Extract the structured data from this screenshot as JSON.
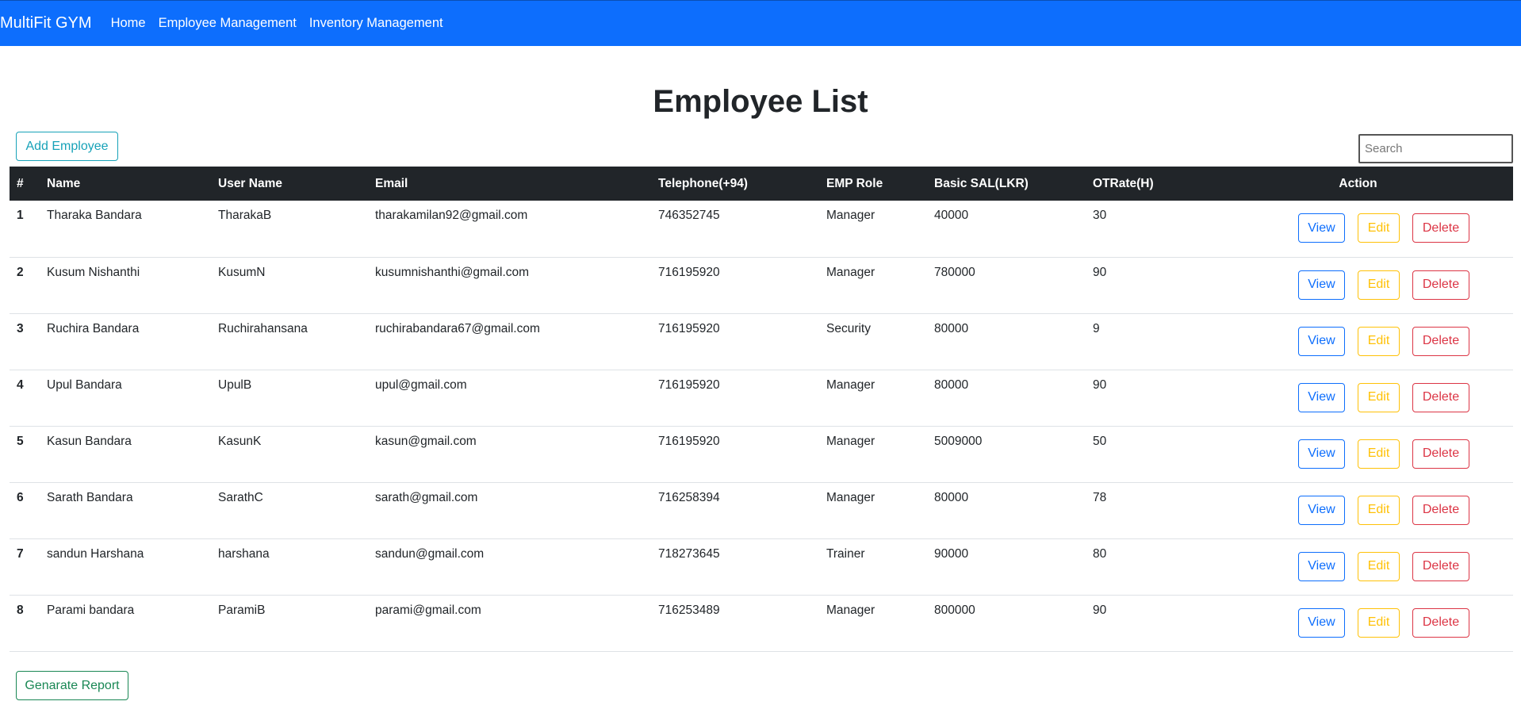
{
  "navbar": {
    "brand": "MultiFit GYM",
    "links": [
      "Home",
      "Employee Management",
      "Inventory Management"
    ]
  },
  "page": {
    "title": "Employee List"
  },
  "toolbar": {
    "add_label": "Add Employee",
    "search_placeholder": "Search"
  },
  "table": {
    "headers": [
      "#",
      "Name",
      "User Name",
      "Email",
      "Telephone(+94)",
      "EMP Role",
      "Basic SAL(LKR)",
      "OTRate(H)",
      "Action"
    ],
    "rows": [
      {
        "num": "1",
        "name": "Tharaka Bandara",
        "username": "TharakaB",
        "email": "tharakamilan92@gmail.com",
        "telephone": "746352745",
        "role": "Manager",
        "salary": "40000",
        "otrate": "30"
      },
      {
        "num": "2",
        "name": "Kusum Nishanthi",
        "username": "KusumN",
        "email": "kusumnishanthi@gmail.com",
        "telephone": "716195920",
        "role": "Manager",
        "salary": "780000",
        "otrate": "90"
      },
      {
        "num": "3",
        "name": "Ruchira Bandara",
        "username": "Ruchirahansana",
        "email": "ruchirabandara67@gmail.com",
        "telephone": "716195920",
        "role": "Security",
        "salary": "80000",
        "otrate": "9"
      },
      {
        "num": "4",
        "name": "Upul Bandara",
        "username": "UpulB",
        "email": "upul@gmail.com",
        "telephone": "716195920",
        "role": "Manager",
        "salary": "80000",
        "otrate": "90"
      },
      {
        "num": "5",
        "name": "Kasun Bandara",
        "username": "KasunK",
        "email": "kasun@gmail.com",
        "telephone": "716195920",
        "role": "Manager",
        "salary": "5009000",
        "otrate": "50"
      },
      {
        "num": "6",
        "name": "Sarath Bandara",
        "username": "SarathC",
        "email": "sarath@gmail.com",
        "telephone": "716258394",
        "role": "Manager",
        "salary": "80000",
        "otrate": "78"
      },
      {
        "num": "7",
        "name": "sandun Harshana",
        "username": "harshana",
        "email": "sandun@gmail.com",
        "telephone": "718273645",
        "role": "Trainer",
        "salary": "90000",
        "otrate": "80"
      },
      {
        "num": "8",
        "name": "Parami bandara",
        "username": "ParamiB",
        "email": "parami@gmail.com",
        "telephone": "716253489",
        "role": "Manager",
        "salary": "800000",
        "otrate": "90"
      }
    ],
    "actions": {
      "view_label": "View",
      "edit_label": "Edit",
      "delete_label": "Delete"
    }
  },
  "footer": {
    "report_label": "Genarate Report"
  },
  "colors": {
    "navbar": "#0d6efd",
    "table_header": "#212529",
    "view": "#0d6efd",
    "edit": "#ffc107",
    "delete": "#dc3545",
    "add": "#17a2b8",
    "report": "#198754"
  }
}
